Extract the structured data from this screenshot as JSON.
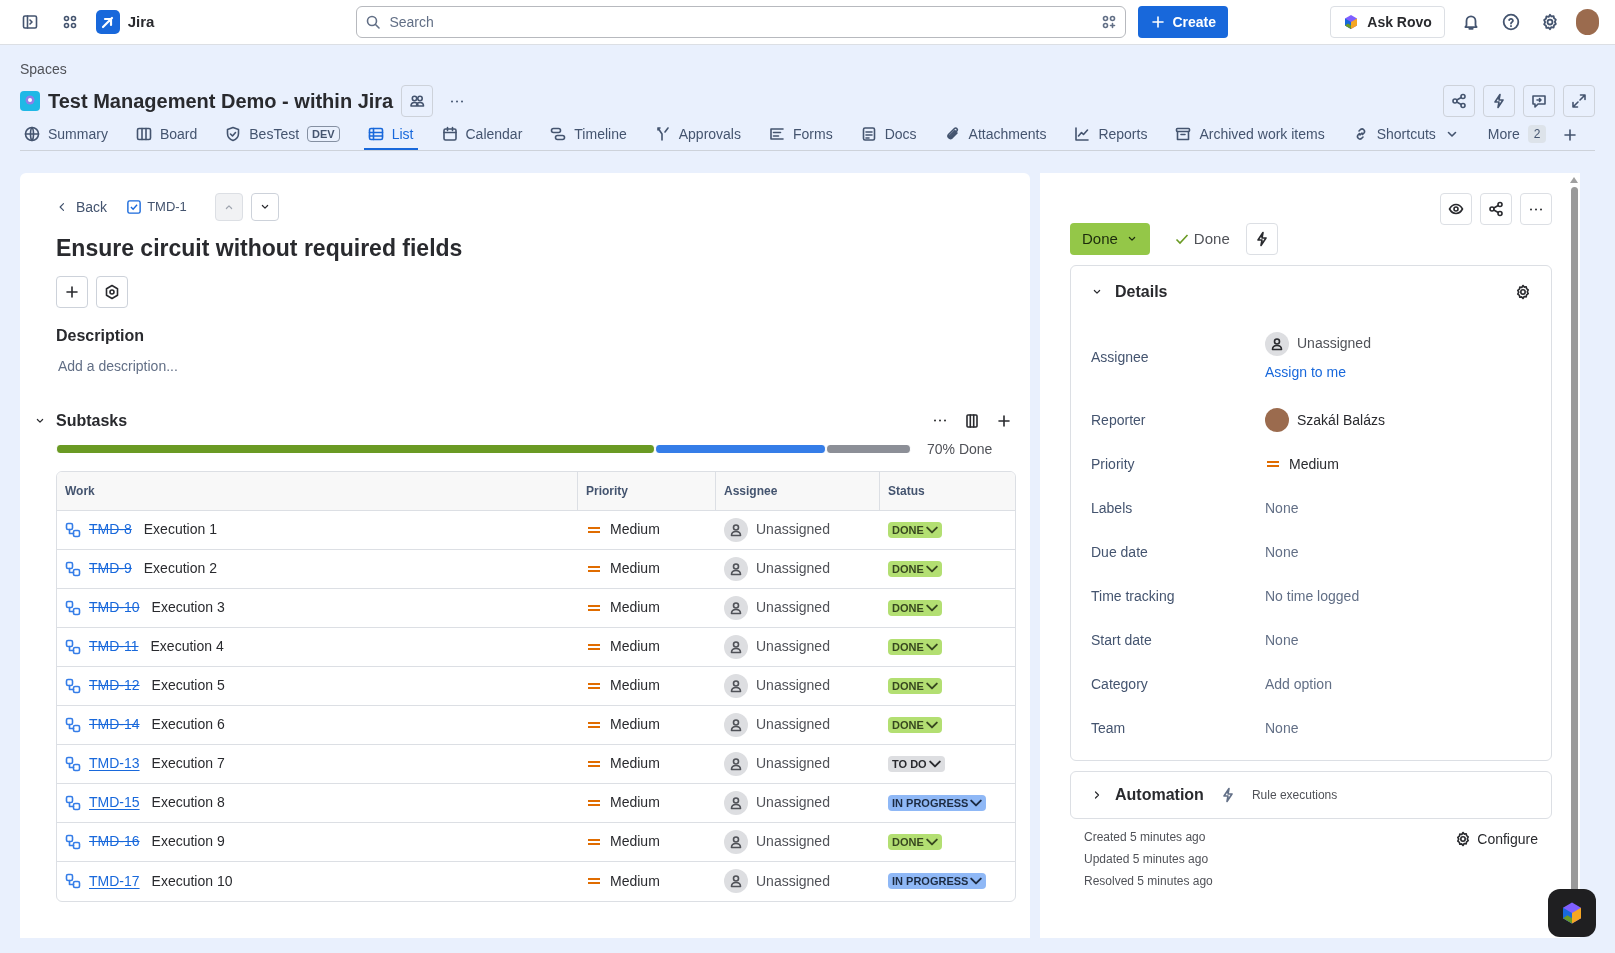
{
  "top_bar": {
    "app_name": "Jira",
    "search": {
      "placeholder": "Search"
    },
    "create_button": "Create",
    "ask_button": "Ask Rovo"
  },
  "space": {
    "breadcrumb": "Spaces",
    "title": "Test Management Demo - within Jira"
  },
  "tabs": [
    {
      "kind": "globe",
      "label": "Summary",
      "selected": false
    },
    {
      "kind": "board",
      "label": "Board",
      "selected": false
    },
    {
      "kind": "shield",
      "label": "BesTest",
      "badge": "DEV",
      "selected": false
    },
    {
      "kind": "list",
      "label": "List",
      "selected": true
    },
    {
      "kind": "calendar",
      "label": "Calendar",
      "selected": false
    },
    {
      "kind": "timeline",
      "label": "Timeline",
      "selected": false
    },
    {
      "kind": "approvals",
      "label": "Approvals",
      "selected": false
    },
    {
      "kind": "forms",
      "label": "Forms",
      "selected": false
    },
    {
      "kind": "docs",
      "label": "Docs",
      "selected": false
    },
    {
      "kind": "clip",
      "label": "Attachments",
      "selected": false
    },
    {
      "kind": "chart",
      "label": "Reports",
      "selected": false
    },
    {
      "kind": "archive",
      "label": "Archived work items",
      "selected": false
    },
    {
      "kind": "link",
      "label": "Shortcuts",
      "selected": false
    },
    {
      "kind": "more",
      "label": "More",
      "badge": "2",
      "selected": false
    }
  ],
  "issue": {
    "back": "Back",
    "key": "TMD-1",
    "title": "Ensure circuit without required fields",
    "description_heading": "Description",
    "description_placeholder": "Add a description..."
  },
  "subtasks": {
    "heading": "Subtasks",
    "progress_label": "70% Done",
    "columns": [
      "Work",
      "Priority",
      "Assignee",
      "Status"
    ],
    "rows": [
      {
        "key": "TMD-8",
        "summary": "Execution 1",
        "priority": "Medium",
        "assignee": "Unassigned",
        "status": "DONE",
        "kind": "done"
      },
      {
        "key": "TMD-9",
        "summary": "Execution 2",
        "priority": "Medium",
        "assignee": "Unassigned",
        "status": "DONE",
        "kind": "done"
      },
      {
        "key": "TMD-10",
        "summary": "Execution 3",
        "priority": "Medium",
        "assignee": "Unassigned",
        "status": "DONE",
        "kind": "done"
      },
      {
        "key": "TMD-11",
        "summary": "Execution 4",
        "priority": "Medium",
        "assignee": "Unassigned",
        "status": "DONE",
        "kind": "done"
      },
      {
        "key": "TMD-12",
        "summary": "Execution 5",
        "priority": "Medium",
        "assignee": "Unassigned",
        "status": "DONE",
        "kind": "done"
      },
      {
        "key": "TMD-14",
        "summary": "Execution 6",
        "priority": "Medium",
        "assignee": "Unassigned",
        "status": "DONE",
        "kind": "done"
      },
      {
        "key": "TMD-13",
        "summary": "Execution 7",
        "priority": "Medium",
        "assignee": "Unassigned",
        "status": "TO DO",
        "kind": "todo"
      },
      {
        "key": "TMD-15",
        "summary": "Execution 8",
        "priority": "Medium",
        "assignee": "Unassigned",
        "status": "IN PROGRESS",
        "kind": "inprogress"
      },
      {
        "key": "TMD-16",
        "summary": "Execution 9",
        "priority": "Medium",
        "assignee": "Unassigned",
        "status": "DONE",
        "kind": "done"
      },
      {
        "key": "TMD-17",
        "summary": "Execution 10",
        "priority": "Medium",
        "assignee": "Unassigned",
        "status": "IN PROGRESS",
        "kind": "inprogress"
      }
    ]
  },
  "side": {
    "status_button": "Done",
    "resolution": "Done",
    "details_heading": "Details",
    "fields": [
      {
        "kind": "assignee",
        "label": "Assignee",
        "value": "Unassigned",
        "action": "Assign to me"
      },
      {
        "kind": "person",
        "label": "Reporter",
        "value": "Szakál Balázs"
      },
      {
        "kind": "priority",
        "label": "Priority",
        "value": "Medium"
      },
      {
        "kind": "empty",
        "label": "Labels",
        "value": "None"
      },
      {
        "kind": "empty",
        "label": "Due date",
        "value": "None"
      },
      {
        "kind": "empty",
        "label": "Time tracking",
        "value": "No time logged"
      },
      {
        "kind": "empty",
        "label": "Start date",
        "value": "None"
      },
      {
        "kind": "empty",
        "label": "Category",
        "value": "Add option"
      },
      {
        "kind": "empty",
        "label": "Team",
        "value": "None"
      }
    ],
    "automation_heading": "Automation",
    "automation_link": "Rule executions",
    "dates": [
      "Created 5 minutes ago",
      "Updated 5 minutes ago",
      "Resolved 5 minutes ago"
    ],
    "configure": "Configure"
  }
}
